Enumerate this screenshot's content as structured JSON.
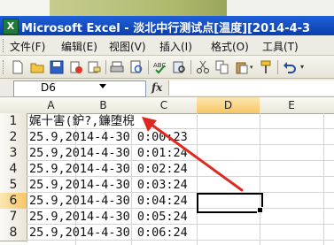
{
  "window": {
    "title": "Microsoft Excel - 淡北中行测试点[温度][2014-4-3",
    "app_icon_letter": "X"
  },
  "menu": {
    "items": [
      "文件(F)",
      "编辑(E)",
      "视图(V)",
      "插入(I)",
      "格式(O)",
      "工具(T)"
    ]
  },
  "formula_bar": {
    "name_box": "D6",
    "fx_label": "fx",
    "formula_value": ""
  },
  "grid": {
    "columns": [
      "A",
      "B",
      "C",
      "D",
      "E"
    ],
    "active_column": "D",
    "rows": [
      "1",
      "2",
      "3",
      "4",
      "5",
      "6",
      "7",
      "8"
    ],
    "active_row": "6",
    "cells": [
      "娓十害(鈩?,鐮堕棿",
      "25.9,2014-4-30 0:00:23",
      "25.9,2014-4-30 0:01:24",
      "25.9,2014-4-30 0:02:24",
      "25.9,2014-4-30 0:03:24",
      "25.9,2014-4-30 0:04:24",
      "25.9,2014-4-30 0:05:24",
      "25.9,2014-4-30 0:06:24"
    ],
    "annotation_arrow_color": "#e0281e"
  },
  "icons": {
    "toolbar": [
      "new-icon",
      "open-icon",
      "save-icon",
      "permission-icon",
      "email-icon",
      "print-icon",
      "print-preview-icon",
      "spelling-icon",
      "research-icon",
      "cut-icon",
      "copy-icon",
      "paste-icon",
      "format-painter-icon",
      "undo-icon"
    ]
  }
}
